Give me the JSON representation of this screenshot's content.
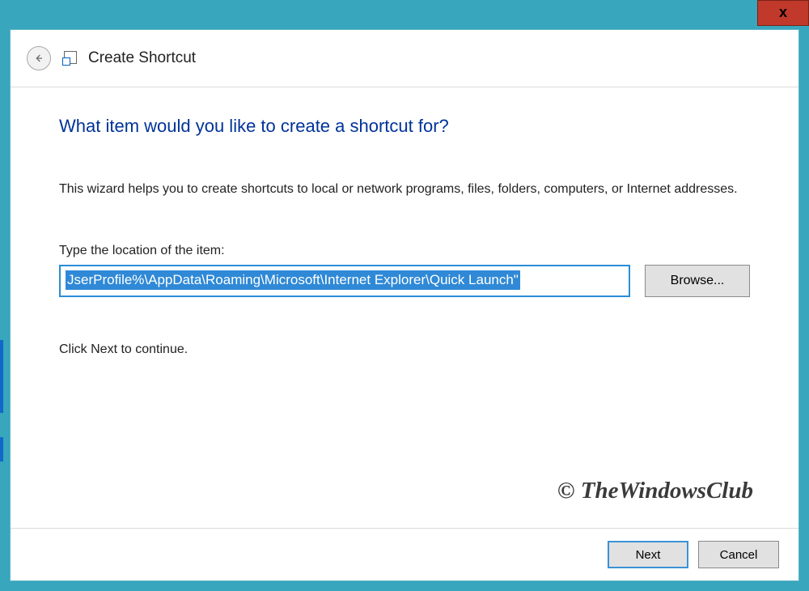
{
  "window": {
    "close_glyph": "x"
  },
  "wizard": {
    "title": "Create Shortcut",
    "heading": "What item would you like to create a shortcut for?",
    "description": "This wizard helps you to create shortcuts to local or network programs, files, folders, computers, or Internet addresses.",
    "field_label": "Type the location of the item:",
    "path_value": "JserProfile%\\AppData\\Roaming\\Microsoft\\Internet Explorer\\Quick Launch\"",
    "browse_label": "Browse...",
    "continue_hint": "Click Next to continue."
  },
  "footer": {
    "next_label": "Next",
    "cancel_label": "Cancel"
  },
  "watermark": "© TheWindowsClub"
}
